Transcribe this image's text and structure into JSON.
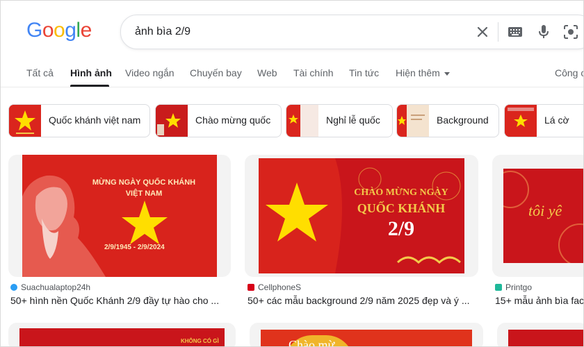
{
  "logo": {
    "letters": [
      "G",
      "o",
      "o",
      "g",
      "l",
      "e"
    ],
    "colors": [
      "#4285F4",
      "#EA4335",
      "#FBBC05",
      "#4285F4",
      "#34A853",
      "#EA4335"
    ]
  },
  "search": {
    "query": "ảnh bìa 2/9",
    "icons": [
      "close-icon",
      "keyboard-icon",
      "mic-icon",
      "lens-icon"
    ]
  },
  "tabs": [
    "Tất cả",
    "Hình ảnh",
    "Video ngắn",
    "Chuyến bay",
    "Web",
    "Tài chính",
    "Tin tức",
    "Hiện thêm",
    "Công c"
  ],
  "chips": [
    {
      "label": "Quốc khánh việt nam"
    },
    {
      "label": "Chào mừng quốc"
    },
    {
      "label": "Nghỉ lễ quốc"
    },
    {
      "label": "Background"
    },
    {
      "label": "Lá cờ"
    }
  ],
  "results": [
    {
      "source": "Suachualaptop24h",
      "title": "50+ hình nền Quốc Khánh 2/9 đầy tự hào cho ...",
      "image_text": [
        "MỪNG NGÀY QUỐC KHÁNH",
        "VIỆT NAM",
        "2/9/1945 - 2/9/2024"
      ]
    },
    {
      "source": "CellphoneS",
      "title": "50+ các mẫu background 2/9 năm 2025 đẹp và ý ...",
      "image_text": [
        "CHÀO MỪNG NGÀY",
        "QUỐC KHÁNH",
        "2/9"
      ]
    },
    {
      "source": "Printgo",
      "title": "15+ mẫu ảnh bìa fac",
      "image_text": [
        "tôi yê"
      ]
    }
  ],
  "row2_text": [
    "KHÔNG CÓ GÌ",
    "Chào mừ"
  ],
  "colors": {
    "flag_red": "#DA251D",
    "star_yellow": "#FFDE00",
    "gold": "#F3C94A"
  }
}
